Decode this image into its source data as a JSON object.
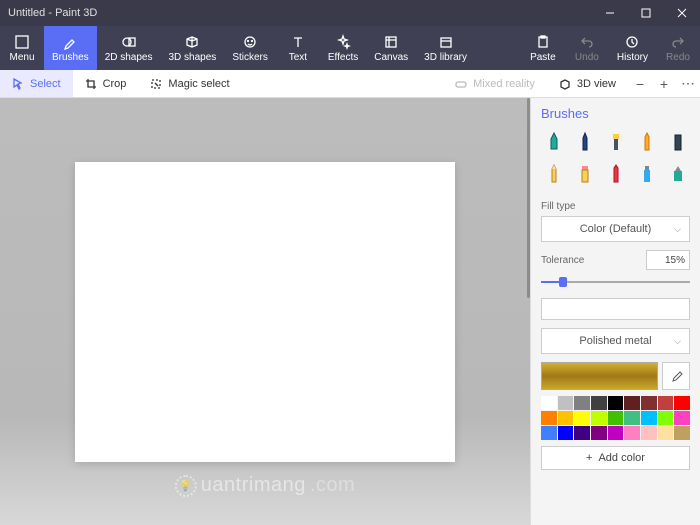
{
  "title": "Untitled - Paint 3D",
  "ribbon": {
    "menu": "Menu",
    "brushes": "Brushes",
    "shapes2d": "2D shapes",
    "shapes3d": "3D shapes",
    "stickers": "Stickers",
    "text": "Text",
    "effects": "Effects",
    "canvas": "Canvas",
    "library": "3D library",
    "paste": "Paste",
    "undo": "Undo",
    "history": "History",
    "redo": "Redo"
  },
  "subbar": {
    "select": "Select",
    "crop": "Crop",
    "magic": "Magic select",
    "mixed": "Mixed reality",
    "view3d": "3D view"
  },
  "side": {
    "title": "Brushes",
    "fillType": "Fill type",
    "fillValue": "Color (Default)",
    "tolerance": "Tolerance",
    "toleranceValue": "15%",
    "material": "Polished metal",
    "addColor": "Add color"
  },
  "palette": {
    "row1": [
      "#ffffff",
      "#c0c0c0",
      "#808080",
      "#404040",
      "#000000",
      "#602020",
      "#803030",
      "#c04040",
      "#ff0000"
    ],
    "row2": [
      "#ff8000",
      "#ffc000",
      "#ffff00",
      "#c0ff00",
      "#40c000",
      "#40c080",
      "#00c0ff",
      "#80ff00",
      "#ff40c0"
    ],
    "row3": [
      "#4080ff",
      "#0000ff",
      "#400080",
      "#800080",
      "#c000c0",
      "#ff80c0",
      "#ffc0c0",
      "#ffe0a0",
      "#c0a060"
    ]
  },
  "watermark": "uantrimang"
}
